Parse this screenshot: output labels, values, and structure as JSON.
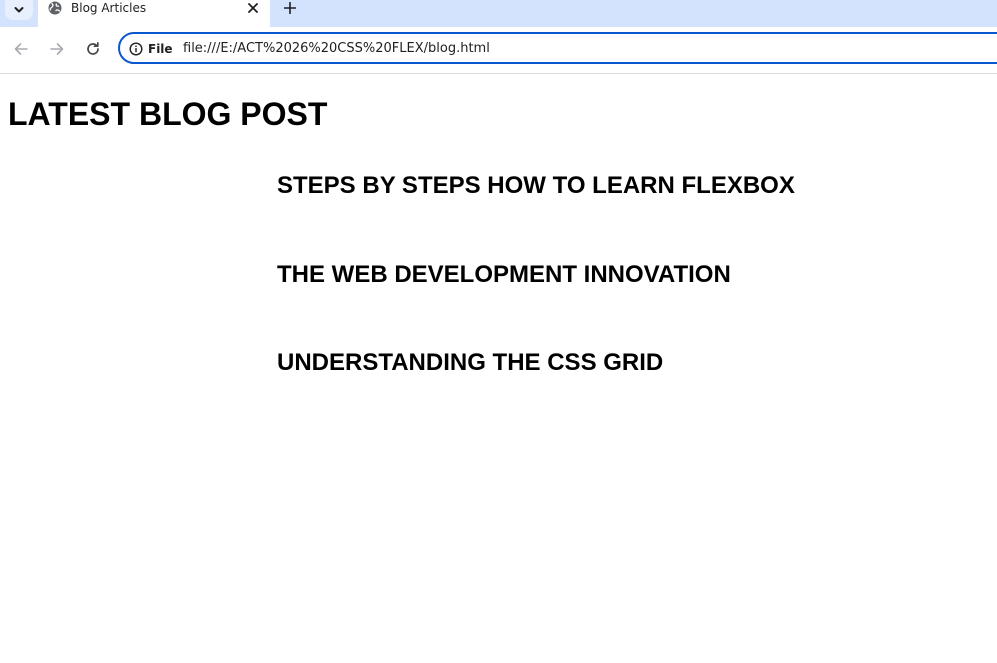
{
  "browser": {
    "tab": {
      "title": "Blog Articles",
      "favicon": "globe-icon"
    },
    "new_tab_icon": "plus-icon",
    "tab_search_icon": "chevron-down-icon",
    "toolbar": {
      "back_icon": "arrow-left-icon",
      "forward_icon": "arrow-right-icon",
      "reload_icon": "reload-icon",
      "site_info_icon": "info-icon",
      "site_info_label": "File",
      "url": "file:///E:/ACT%2026%20CSS%20FLEX/blog.html"
    },
    "colors": {
      "tabstrip_bg": "#d3e3fd",
      "omnibox_border": "#0b57d0"
    }
  },
  "page": {
    "heading": "LATEST BLOG POST",
    "posts": [
      "STEPS BY STEPS HOW TO LEARN FLEXBOX",
      "THE WEB DEVELOPMENT INNOVATION",
      "UNDERSTANDING THE CSS GRID"
    ]
  }
}
